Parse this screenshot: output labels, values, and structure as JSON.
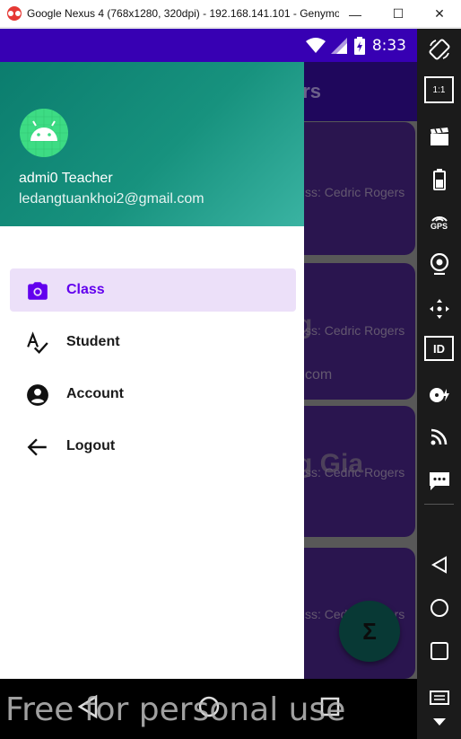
{
  "window": {
    "title": "Google Nexus 4 (768x1280, 320dpi) - 192.168.141.101 - Genymot...",
    "minimize_glyph": "—",
    "maximize_glyph": "☐",
    "close_glyph": "✕"
  },
  "statusbar": {
    "time": "8:33"
  },
  "appbar": {
    "title_fragment": "ers"
  },
  "cards": [
    {
      "line1": "ss: Cedric Rogers"
    },
    {
      "title": "g",
      "line1": "ss: Cedric Rogers",
      "line2": "com"
    },
    {
      "title": "g Gia",
      "line1": "ss: Cedric Rogers"
    },
    {
      "line1": "ss: Cedric Rogers"
    }
  ],
  "fab": {
    "glyph": "Σ"
  },
  "drawer": {
    "user_name": "admi0 Teacher",
    "user_email": "ledangtuankhoi2@gmail.com",
    "items": [
      {
        "label": "Class",
        "icon": "camera-icon",
        "active": true
      },
      {
        "label": "Student",
        "icon": "spellcheck-icon",
        "active": false
      },
      {
        "label": "Account",
        "icon": "account-circle-icon",
        "active": false
      },
      {
        "label": "Logout",
        "icon": "arrow-back-icon",
        "active": false
      }
    ]
  },
  "watermark": "Free for personal use",
  "colors": {
    "accent": "#6200ee",
    "active_bg": "#ece0f9",
    "header_start": "#0b7d6e",
    "header_end": "#3ab3a2",
    "statusbar": "#3700b3"
  },
  "sidebar_icons": [
    "rotate-icon",
    "pixel-perfect-icon",
    "capture-icon",
    "battery-icon",
    "gps-icon",
    "camera-icon",
    "navigation-icon",
    "device-id-icon",
    "disk-icon",
    "cast-icon",
    "sms-icon",
    "back-icon",
    "home-icon",
    "recents-icon",
    "menu-icon",
    "scroll-down-icon"
  ],
  "sidebar_labels": {
    "pixel_perfect": "1:1",
    "gps": "GPS",
    "id": "ID"
  }
}
